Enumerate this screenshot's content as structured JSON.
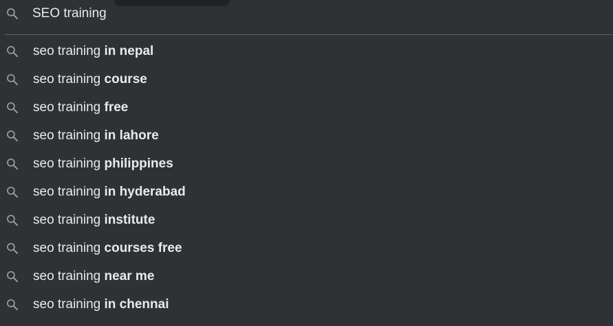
{
  "search": {
    "value": "SEO training",
    "icon": "search-icon"
  },
  "colors": {
    "background": "#303134",
    "text": "#e8eaed",
    "icon": "#9aa0a6",
    "divider": "#5f6368"
  },
  "suggestions": [
    {
      "prefix": "seo training ",
      "suffix": "in nepal",
      "icon": "search-icon"
    },
    {
      "prefix": "seo training ",
      "suffix": "course",
      "icon": "search-icon"
    },
    {
      "prefix": "seo training ",
      "suffix": "free",
      "icon": "search-icon"
    },
    {
      "prefix": "seo training ",
      "suffix": "in lahore",
      "icon": "search-icon"
    },
    {
      "prefix": "seo training ",
      "suffix": "philippines",
      "icon": "search-icon"
    },
    {
      "prefix": "seo training ",
      "suffix": "in hyderabad",
      "icon": "search-icon"
    },
    {
      "prefix": "seo training ",
      "suffix": "institute",
      "icon": "search-icon"
    },
    {
      "prefix": "seo training ",
      "suffix": "courses free",
      "icon": "search-icon"
    },
    {
      "prefix": "seo training ",
      "suffix": "near me",
      "icon": "search-icon"
    },
    {
      "prefix": "seo training ",
      "suffix": "in chennai",
      "icon": "search-icon"
    }
  ]
}
